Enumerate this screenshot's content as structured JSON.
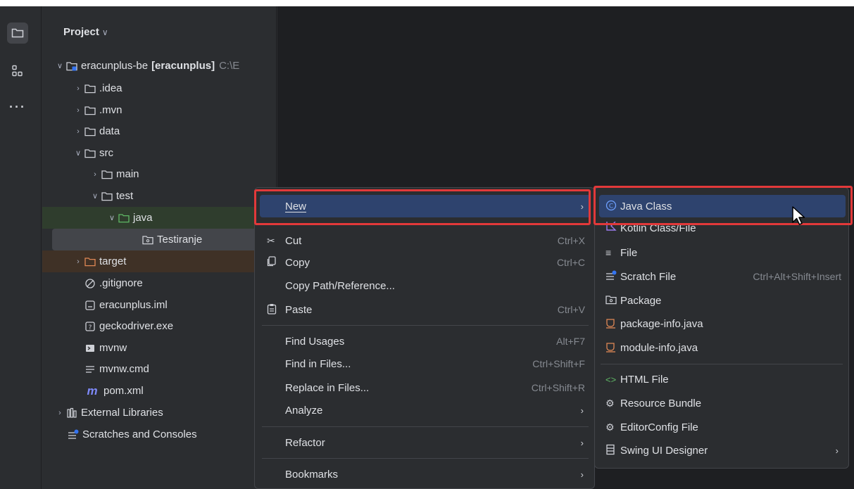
{
  "project_panel": {
    "title": "Project",
    "tree": [
      {
        "label": "eracunplus-be",
        "module": "[eracunplus]",
        "path": "C:\\E",
        "expanded": true,
        "icon": "module-folder-icon"
      },
      {
        "label": ".idea",
        "icon": "folder-icon"
      },
      {
        "label": ".mvn",
        "icon": "folder-icon"
      },
      {
        "label": "data",
        "icon": "folder-icon"
      },
      {
        "label": "src",
        "icon": "folder-icon",
        "expanded": true
      },
      {
        "label": "main",
        "icon": "folder-icon"
      },
      {
        "label": "test",
        "icon": "folder-icon",
        "expanded": true
      },
      {
        "label": "java",
        "icon": "test-source-folder-icon",
        "expanded": true
      },
      {
        "label": "Testiranje",
        "icon": "package-icon",
        "selected": true
      },
      {
        "label": "target",
        "icon": "excluded-folder-icon"
      },
      {
        "label": ".gitignore",
        "icon": "ignore-file-icon"
      },
      {
        "label": "eracunplus.iml",
        "icon": "iml-file-icon"
      },
      {
        "label": "geckodriver.exe",
        "icon": "unknown-file-icon"
      },
      {
        "label": "mvnw",
        "icon": "script-file-icon"
      },
      {
        "label": "mvnw.cmd",
        "icon": "text-file-icon"
      },
      {
        "label": "pom.xml",
        "icon": "maven-icon"
      },
      {
        "label": "External Libraries",
        "icon": "library-icon"
      },
      {
        "label": "Scratches and Consoles",
        "icon": "scratch-icon"
      }
    ]
  },
  "context_menu": {
    "items": [
      {
        "label": "New",
        "icon": "",
        "shortcut": "",
        "submenu": true,
        "active": true
      },
      {
        "label": "Cut",
        "icon": "scissors-icon",
        "shortcut": "Ctrl+X"
      },
      {
        "label": "Copy",
        "icon": "copy-icon",
        "shortcut": "Ctrl+C"
      },
      {
        "label": "Copy Path/Reference...",
        "icon": "",
        "shortcut": ""
      },
      {
        "label": "Paste",
        "icon": "paste-icon",
        "shortcut": "Ctrl+V"
      },
      {
        "label": "Find Usages",
        "icon": "",
        "shortcut": "Alt+F7"
      },
      {
        "label": "Find in Files...",
        "icon": "",
        "shortcut": "Ctrl+Shift+F"
      },
      {
        "label": "Replace in Files...",
        "icon": "",
        "shortcut": "Ctrl+Shift+R"
      },
      {
        "label": "Analyze",
        "icon": "",
        "shortcut": "",
        "submenu": true
      },
      {
        "label": "Refactor",
        "icon": "",
        "shortcut": "",
        "submenu": true
      },
      {
        "label": "Bookmarks",
        "icon": "",
        "shortcut": "",
        "submenu": true
      }
    ]
  },
  "new_submenu": {
    "items": [
      {
        "label": "Java Class",
        "icon": "java-class-icon",
        "shortcut": "",
        "active": true
      },
      {
        "label": "Kotlin Class/File",
        "icon": "kotlin-icon",
        "shortcut": ""
      },
      {
        "label": "File",
        "icon": "file-icon",
        "shortcut": ""
      },
      {
        "label": "Scratch File",
        "icon": "scratch-file-icon",
        "shortcut": "Ctrl+Alt+Shift+Insert"
      },
      {
        "label": "Package",
        "icon": "package-icon",
        "shortcut": ""
      },
      {
        "label": "package-info.java",
        "icon": "java-file-icon",
        "shortcut": ""
      },
      {
        "label": "module-info.java",
        "icon": "java-file-icon",
        "shortcut": ""
      },
      {
        "label": "HTML File",
        "icon": "html-icon",
        "shortcut": ""
      },
      {
        "label": "Resource Bundle",
        "icon": "resource-bundle-icon",
        "shortcut": ""
      },
      {
        "label": "EditorConfig File",
        "icon": "editorconfig-icon",
        "shortcut": ""
      },
      {
        "label": "Swing UI Designer",
        "icon": "swing-icon",
        "shortcut": "",
        "submenu": true
      }
    ]
  },
  "colors": {
    "accent_active": "#2e436e",
    "highlight_red": "#e2393a",
    "panel_bg": "#2b2d30",
    "editor_bg": "#1e1f22"
  }
}
